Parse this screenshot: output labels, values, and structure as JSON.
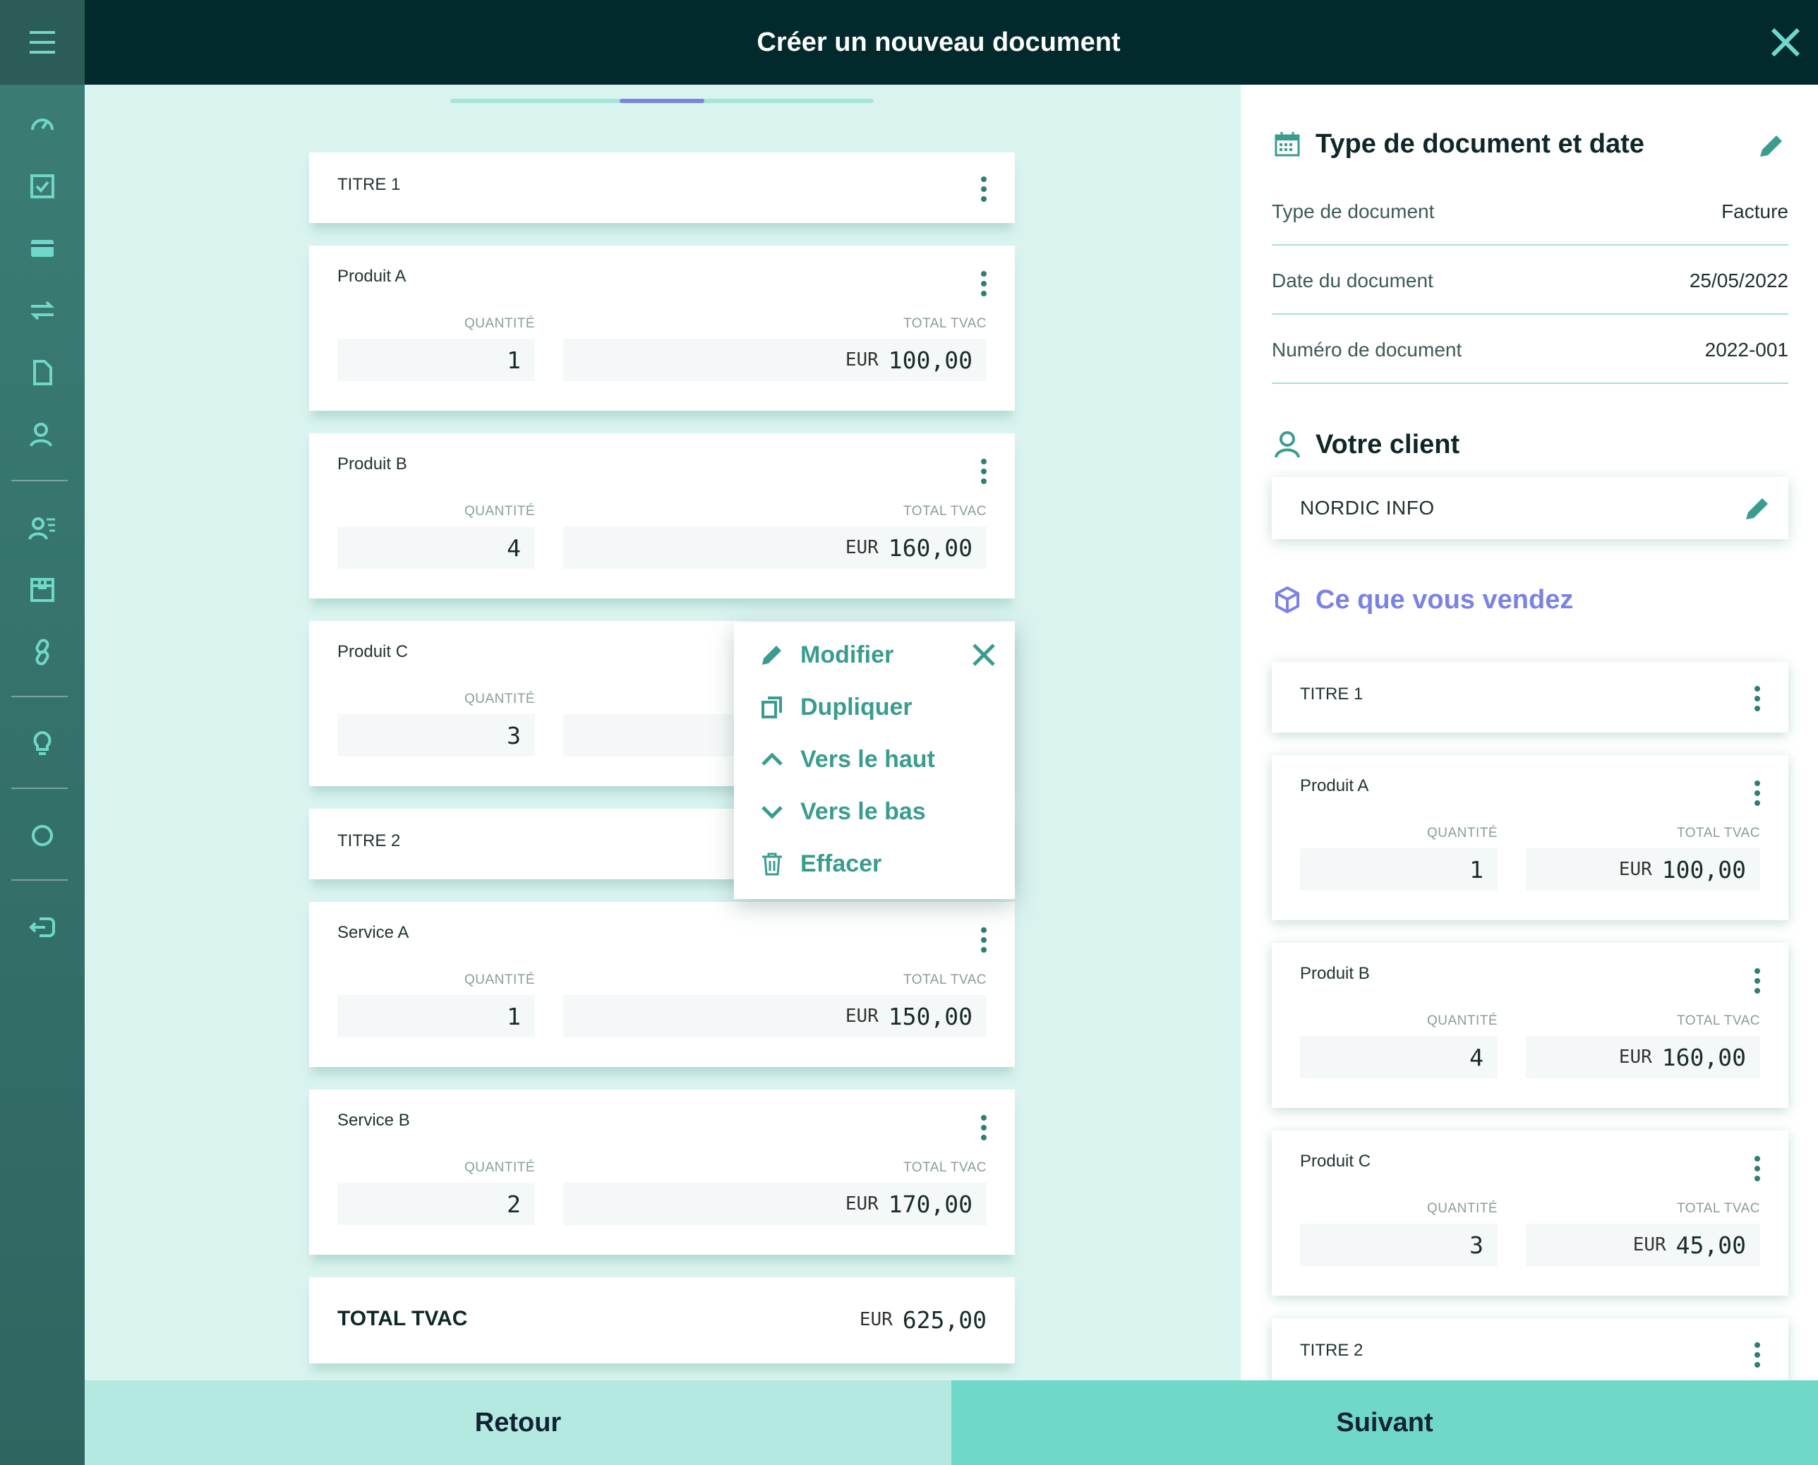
{
  "header": {
    "title": "Créer un nouveau document"
  },
  "sidebar": {
    "icons": [
      "menu-icon",
      "dashboard-icon",
      "checkbox-icon",
      "card-icon",
      "transfer-icon",
      "document-icon",
      "users-icon",
      "contacts-icon",
      "box-icon",
      "link-icon",
      "bulb-icon",
      "circle-icon",
      "logout-icon"
    ]
  },
  "progress": {
    "current_step_fraction": 0.4
  },
  "items": {
    "titre1": {
      "name": "TITRE 1"
    },
    "produit_a": {
      "name": "Produit A",
      "qty_label": "QUANTITÉ",
      "qty": "1",
      "total_label": "TOTAL TVAC",
      "currency": "EUR",
      "amount": "100,00"
    },
    "produit_b": {
      "name": "Produit B",
      "qty_label": "QUANTITÉ",
      "qty": "4",
      "total_label": "TOTAL TVAC",
      "currency": "EUR",
      "amount": "160,00"
    },
    "produit_c": {
      "name": "Produit C",
      "qty_label": "QUANTITÉ",
      "qty": "3"
    },
    "titre2": {
      "name": "TITRE 2"
    },
    "service_a": {
      "name": "Service A",
      "qty_label": "QUANTITÉ",
      "qty": "1",
      "total_label": "TOTAL TVAC",
      "currency": "EUR",
      "amount": "150,00"
    },
    "service_b": {
      "name": "Service B",
      "qty_label": "QUANTITÉ",
      "qty": "2",
      "total_label": "TOTAL TVAC",
      "currency": "EUR",
      "amount": "170,00"
    },
    "total": {
      "label": "TOTAL TVAC",
      "currency": "EUR",
      "amount": "625,00"
    }
  },
  "context_menu": {
    "modify": "Modifier",
    "duplicate": "Dupliquer",
    "move_up": "Vers le haut",
    "move_down": "Vers le bas",
    "delete": "Effacer"
  },
  "right_panel": {
    "doc_section": {
      "title": "Type de document et date",
      "rows": [
        {
          "label": "Type de document",
          "value": "Facture"
        },
        {
          "label": "Date du document",
          "value": "25/05/2022"
        },
        {
          "label": "Numéro de document",
          "value": "2022-001"
        }
      ]
    },
    "client_section": {
      "title": "Votre client",
      "client_name": "NORDIC INFO"
    },
    "sell_section": {
      "title": "Ce que vous vendez",
      "title_color": "#7b82e6",
      "items": [
        {
          "name": "TITRE 1"
        },
        {
          "name": "Produit A",
          "qty_label": "QUANTITÉ",
          "qty": "1",
          "total_label": "TOTAL TVAC",
          "currency": "EUR",
          "amount": "100,00"
        },
        {
          "name": "Produit B",
          "qty_label": "QUANTITÉ",
          "qty": "4",
          "total_label": "TOTAL TVAC",
          "currency": "EUR",
          "amount": "160,00"
        },
        {
          "name": "Produit C",
          "qty_label": "QUANTITÉ",
          "qty": "3",
          "total_label": "TOTAL TVAC",
          "currency": "EUR",
          "amount": "45,00"
        },
        {
          "name": "TITRE 2"
        }
      ]
    }
  },
  "footer": {
    "back_label": "Retour",
    "next_label": "Suivant"
  },
  "colors": {
    "accent": "#3a9c8f",
    "header_bg": "#02292b",
    "purple": "#7b82e6"
  }
}
